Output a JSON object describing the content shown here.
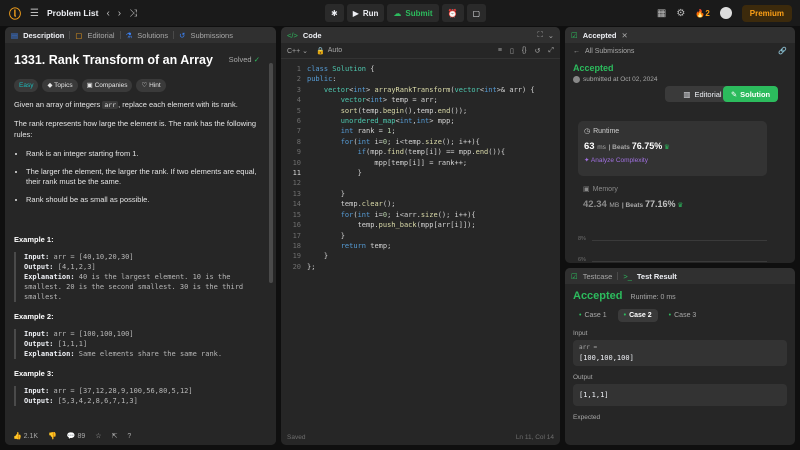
{
  "topbar": {
    "problem_list": "Problem List",
    "run": "Run",
    "submit": "Submit",
    "streak": "2",
    "premium": "Premium"
  },
  "desc": {
    "tabs": [
      "Description",
      "Editorial",
      "Solutions",
      "Submissions"
    ],
    "title": "1331. Rank Transform of an Array",
    "solved": "Solved",
    "tags": [
      "Easy",
      "Topics",
      "Companies",
      "Hint"
    ],
    "intro_a": "Given an array of integers ",
    "intro_code": "arr",
    "intro_b": ", replace each element with its rank.",
    "rank_rep": "The rank represents how large the element is. The rank has the following rules:",
    "rules": [
      "Rank is an integer starting from 1.",
      "The larger the element, the larger the rank. If two elements are equal, their rank must be the same.",
      "Rank should be as small as possible."
    ],
    "examples": [
      {
        "h": "Example 1:",
        "input": "arr = [40,10,20,30]",
        "output": "[4,1,2,3]",
        "expl": "40 is the largest element. 10 is the smallest. 20 is the second smallest. 30 is the third smallest."
      },
      {
        "h": "Example 2:",
        "input": "arr = [100,100,100]",
        "output": "[1,1,1]",
        "expl": "Same elements share the same rank."
      },
      {
        "h": "Example 3:",
        "input": "arr = [37,12,28,9,100,56,80,5,12]",
        "output": "[5,3,4,2,8,6,7,1,3]"
      }
    ],
    "labels": {
      "input": "Input:",
      "output": "Output:",
      "expl": "Explanation:"
    },
    "footer": {
      "likes": "2.1K",
      "comments": "89"
    }
  },
  "code": {
    "title": "Code",
    "lang": "C++",
    "auto": "Auto",
    "line_numbers": [
      "1",
      "2",
      "3",
      "4",
      "5",
      "6",
      "7",
      "8",
      "9",
      "10",
      "11",
      "12",
      "13",
      "14",
      "15",
      "16",
      "17",
      "18",
      "19",
      "20"
    ],
    "status": "Saved",
    "cursor": "Ln 11, Col 14"
  },
  "accepted": {
    "tab": "Accepted",
    "all": "All Submissions",
    "title": "Accepted",
    "submitted": "submitted at Oct 02, 2024",
    "editorial": "Editorial",
    "solution": "Solution",
    "runtime_lbl": "Runtime",
    "runtime_val": "63",
    "runtime_unit": "ms",
    "beats_lbl": "Beats",
    "runtime_beats": "76.75%",
    "analyze": "Analyze Complexity",
    "memory_lbl": "Memory",
    "memory_val": "42.34",
    "memory_unit": "MB",
    "memory_beats": "77.16%",
    "axis": [
      "8%",
      "6%"
    ]
  },
  "test": {
    "tabs": [
      "Testcase",
      "Test Result"
    ],
    "status": "Accepted",
    "runtime": "Runtime: 0 ms",
    "cases": [
      "Case 1",
      "Case 2",
      "Case 3"
    ],
    "input_lbl": "Input",
    "var": "arr =",
    "input_val": "[100,100,100]",
    "output_lbl": "Output",
    "output_val": "[1,1,1]",
    "expected_lbl": "Expected"
  }
}
